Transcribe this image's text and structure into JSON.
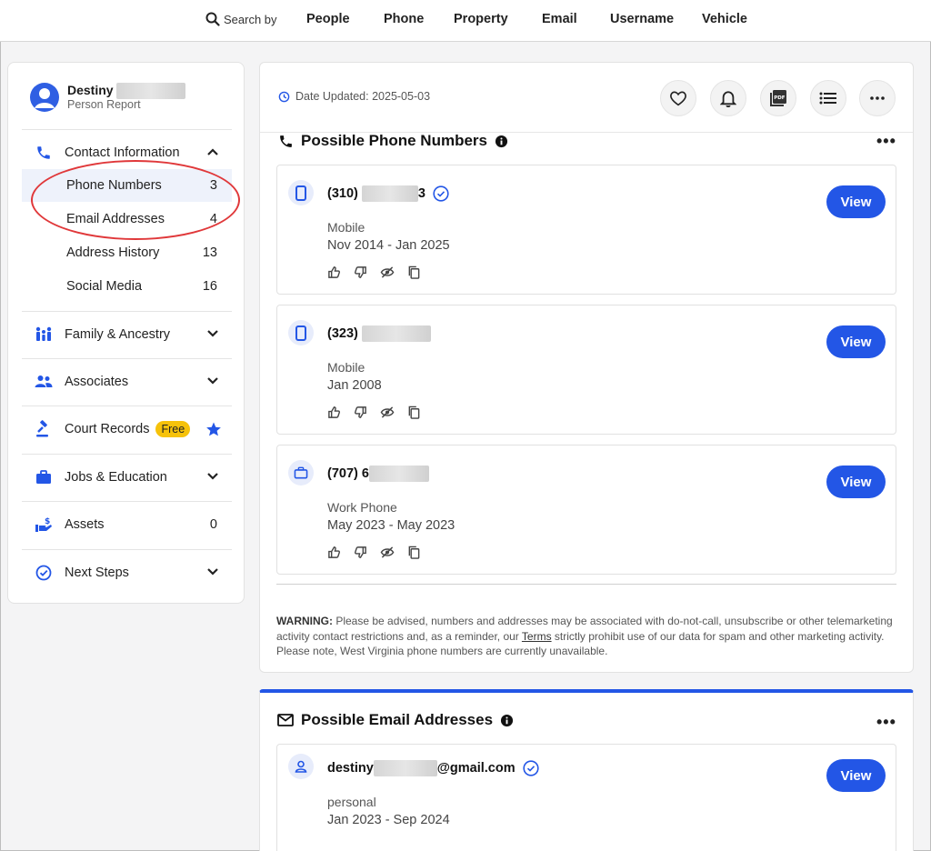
{
  "nav": {
    "search_label": "Search by",
    "links": [
      "People",
      "Phone",
      "Property",
      "Email",
      "Username",
      "Vehicle"
    ]
  },
  "person": {
    "first_name": "Destiny",
    "subtitle": "Person Report"
  },
  "sidebar": {
    "contact": {
      "label": "Contact Information"
    },
    "sub_items": [
      {
        "label": "Phone Numbers",
        "count": "3"
      },
      {
        "label": "Email Addresses",
        "count": "4"
      },
      {
        "label": "Address History",
        "count": "13"
      },
      {
        "label": "Social Media",
        "count": "16"
      }
    ],
    "sections": [
      {
        "label": "Family & Ancestry"
      },
      {
        "label": "Associates"
      },
      {
        "label": "Court Records",
        "badge": "Free"
      },
      {
        "label": "Jobs & Education"
      },
      {
        "label": "Assets",
        "count": "0"
      },
      {
        "label": "Next Steps"
      }
    ]
  },
  "toolbar": {
    "date_updated": "Date Updated: 2025-05-03"
  },
  "phones": {
    "title": "Possible Phone Numbers",
    "items": [
      {
        "prefix": "(310)",
        "suffix": "3",
        "type": "Mobile",
        "dates": "Nov 2014 - Jan 2025",
        "view": "View"
      },
      {
        "prefix": "(323)",
        "suffix": "",
        "type": "Mobile",
        "dates": "Jan 2008",
        "view": "View"
      },
      {
        "prefix": "(707) 6",
        "suffix": "",
        "type": "Work Phone",
        "dates": "May 2023 - May 2023",
        "view": "View"
      }
    ],
    "warning_label": "WARNING:",
    "warning_text_1": " Please be advised, numbers and addresses may be associated with do-not-call, unsubscribe or other telemarketing activity contact restrictions and, as a reminder, our ",
    "warning_terms": "Terms",
    "warning_text_2": " strictly prohibit use of our data for spam and other marketing activity. Please note, West Virginia phone numbers are currently unavailable."
  },
  "emails": {
    "title": "Possible Email Addresses",
    "items": [
      {
        "prefix": "destiny",
        "suffix": "@gmail.com",
        "type": "personal",
        "dates": "Jan 2023 - Sep 2024",
        "view": "View"
      }
    ]
  },
  "colors": {
    "accent": "#2356e6",
    "highlight": "#e0383a",
    "badge": "#f6c20a"
  }
}
